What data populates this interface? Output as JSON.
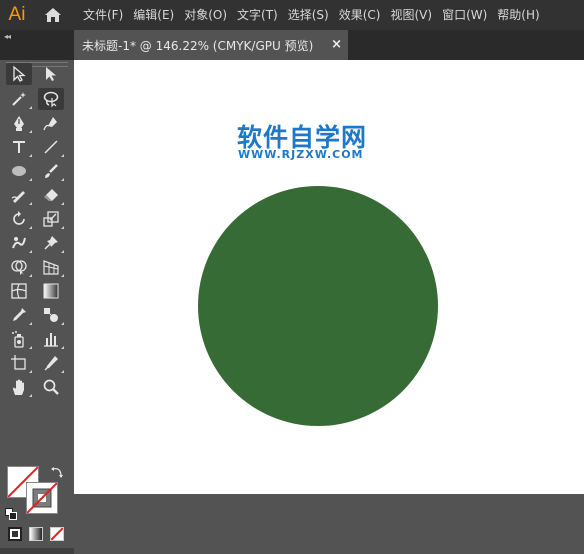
{
  "app": {
    "logo": "Ai",
    "home_icon": "home-icon"
  },
  "menu": [
    "文件(F)",
    "编辑(E)",
    "对象(O)",
    "文字(T)",
    "选择(S)",
    "效果(C)",
    "视图(V)",
    "窗口(W)",
    "帮助(H)"
  ],
  "document": {
    "tab_title": "未标题-1* @ 146.22% (CMYK/GPU 预览)",
    "close_symbol": "×"
  },
  "watermark": {
    "title": "软件自学网",
    "url": "WWW.RJZXW.COM"
  },
  "shape": {
    "type": "circle",
    "fill": "#376B35"
  },
  "colors": {
    "accent": "#FF9A00",
    "watermark": "#1e78c8",
    "circle_fill": "#376B35"
  },
  "toolbar": {
    "collapse_symbol": "◂◂",
    "tools": [
      "selection-tool-icon",
      "direct-selection-tool-icon",
      "magic-wand-icon",
      "lasso-icon",
      "pen-icon",
      "curvature-icon",
      "type-icon",
      "line-icon",
      "ellipse-icon",
      "paintbrush-icon",
      "shaper-icon",
      "eraser-icon",
      "rotate-icon",
      "scale-icon",
      "warp-icon",
      "puppet-warp-icon",
      "shape-builder-icon",
      "perspective-grid-icon",
      "mesh-icon",
      "gradient-icon",
      "eyedropper-icon",
      "blend-icon",
      "symbol-sprayer-icon",
      "graph-icon",
      "artboard-icon",
      "slice-icon",
      "hand-icon",
      "zoom-icon"
    ]
  }
}
